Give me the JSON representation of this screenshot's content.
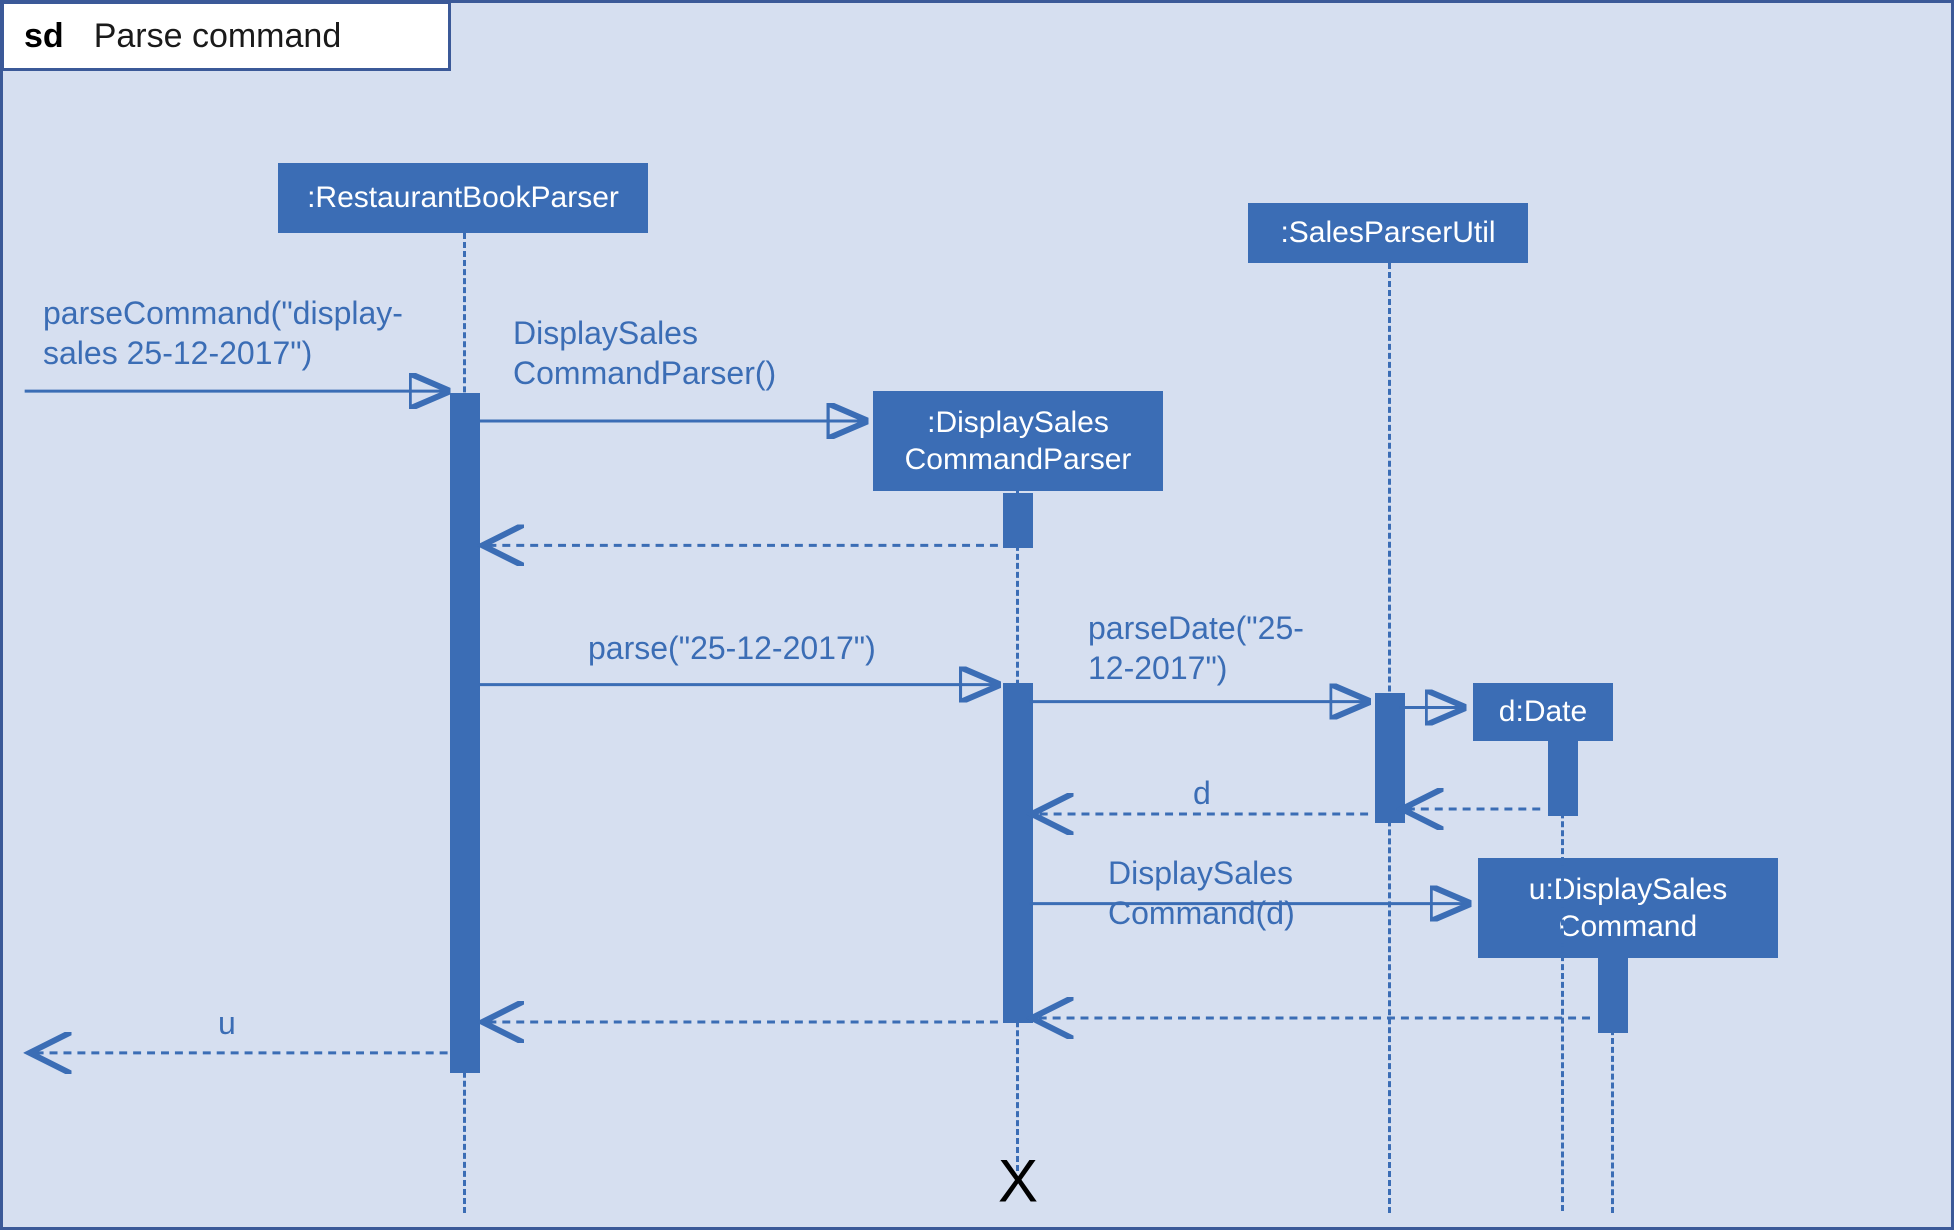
{
  "header": {
    "prefix": "sd",
    "title": "Parse command"
  },
  "objects": {
    "restaurantBookParser": ":RestaurantBookParser",
    "displaySalesCommandParser_line1": ":DisplaySales",
    "displaySalesCommandParser_line2": "CommandParser",
    "salesParserUtil": ":SalesParserUtil",
    "date": "d:Date",
    "displaySalesCommand_line1": "u:DisplaySales",
    "displaySalesCommand_line2": "Command"
  },
  "messages": {
    "parseCommand_line1": "parseCommand(\"display-",
    "parseCommand_line2": "sales 25-12-2017\")",
    "displaySalesCommandParser_line1": "DisplaySales",
    "displaySalesCommandParser_line2": "CommandParser()",
    "parse": "parse(\"25-12-2017\")",
    "parseDate_line1": "parseDate(\"25-",
    "parseDate_line2": "12-2017\")",
    "d_return": "d",
    "displaySalesCommand_line1": "DisplaySales",
    "displaySalesCommand_line2": "Command(d)",
    "u_return": "u"
  }
}
